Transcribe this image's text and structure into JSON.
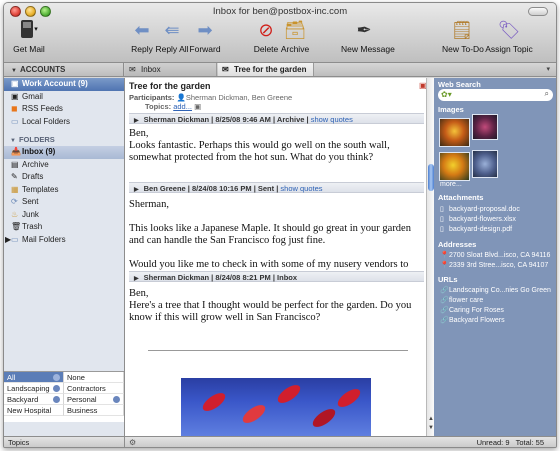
{
  "window": {
    "title": "Inbox for ben@postbox-inc.com"
  },
  "toolbar": {
    "get_mail": "Get Mail",
    "reply": "Reply",
    "reply_all": "Reply All",
    "forward": "Forward",
    "delete": "Delete",
    "archive": "Archive",
    "new_message": "New Message",
    "new_todo": "New To-Do",
    "assign_topic": "Assign Topic"
  },
  "tabs": [
    {
      "label": "Inbox"
    },
    {
      "label": "Tree for the garden"
    }
  ],
  "sidebar": {
    "accounts_label": "ACCOUNTS",
    "accounts": [
      {
        "label": "Work Account (9)"
      },
      {
        "label": "Gmail"
      },
      {
        "label": "RSS Feeds"
      },
      {
        "label": "Local Folders"
      }
    ],
    "folders_label": "FOLDERS",
    "folders": [
      {
        "label": "Inbox (9)"
      },
      {
        "label": "Archive"
      },
      {
        "label": "Drafts"
      },
      {
        "label": "Templates"
      },
      {
        "label": "Sent"
      },
      {
        "label": "Junk"
      },
      {
        "label": "Trash"
      },
      {
        "label": "Mail Folders"
      }
    ],
    "topics_grid": [
      [
        "All",
        "None"
      ],
      [
        "Landscaping",
        "Contractors"
      ],
      [
        "Backyard",
        "Personal"
      ],
      [
        "New Hospital",
        "Business"
      ]
    ],
    "topics_footer": "Topics"
  },
  "message": {
    "subject": "Tree for the garden",
    "participants_label": "Participants:",
    "participants": "Sherman Dickman,  Ben Greene",
    "topics_label": "Topics:",
    "topics_add": "add...",
    "show_quotes": "show quotes",
    "entries": [
      {
        "header": "Sherman Dickman  |  8/25/08 9:46 AM  |  Archive  |",
        "paragraphs": [
          "Ben,",
          "Looks fantastic.  Perhaps this would go well on the south wall, somewhat protected from the hot sun.  What do you think?"
        ]
      },
      {
        "header": "Ben Greene  |  8/24/08 10:16 PM  |  Sent  |",
        "paragraphs": [
          "Sherman,",
          "This looks like a Japanese Maple. It should go great in your garden and can handle the San Francisco fog just fine.",
          "Would you like me to check in with some of my nusery vendors to see if anyone has one in stock?"
        ]
      },
      {
        "header": "Sherman Dickman  |  8/24/08 8:21 PM  |  Inbox",
        "paragraphs": [
          "Ben,",
          "Here's a tree that I thought would be perfect for the garden.  Do you know if this will grow well in San Francisco?"
        ]
      }
    ]
  },
  "right_panel": {
    "web_search_label": "Web Search",
    "images_label": "Images",
    "more": "more...",
    "attachments_label": "Attachments",
    "attachments": [
      "backyard-proposal.doc",
      "backyard-flowers.xlsx",
      "backyard-design.pdf"
    ],
    "addresses_label": "Addresses",
    "addresses": [
      "2700 Sloat Blvd...isco, CA 94116",
      "2339 3rd Stree...isco, CA 94107"
    ],
    "urls_label": "URLs",
    "urls": [
      "Landscaping Co...nies Go Green",
      "flower care",
      "Caring For Roses",
      "Backyard Flowers"
    ]
  },
  "status": {
    "unread": "Unread: 9",
    "total": "Total: 55"
  },
  "colors": {
    "selection": "#4f74b1",
    "right_panel": "#8095b8",
    "link": "#2e62b5"
  }
}
